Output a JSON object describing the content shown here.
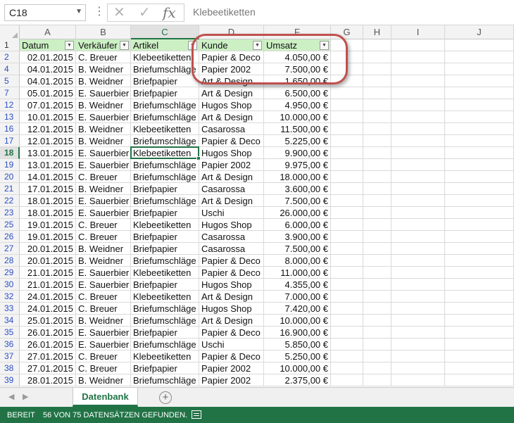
{
  "formula_bar": {
    "name_box": "C18",
    "name_box_arrow": "▼",
    "dots": "⋮",
    "cancel_icon": "✕",
    "enter_icon": "✓",
    "fx_label": "fx",
    "content": "Klebeetiketten"
  },
  "grid": {
    "columns": [
      "A",
      "B",
      "C",
      "D",
      "F",
      "G",
      "H",
      "I",
      "J"
    ],
    "selected_column": "C",
    "header_row_number": "1",
    "headers": [
      "Datum",
      "Verkäufer",
      "Artikel",
      "Kunde",
      "Umsatz"
    ],
    "filter_icon": "▼",
    "active_cell": "C18",
    "rows": [
      {
        "n": "2",
        "cells": [
          "02.01.2015",
          "C. Breuer",
          "Klebeetiketten",
          "Papier & Deco",
          "4.050,00 €"
        ]
      },
      {
        "n": "4",
        "cells": [
          "04.01.2015",
          "B. Weidner",
          "Briefumschläge",
          "Papier 2002",
          "7.500,00 €"
        ]
      },
      {
        "n": "5",
        "cells": [
          "04.01.2015",
          "B. Weidner",
          "Briefpapier",
          "Art & Design",
          "1.650,00 €"
        ]
      },
      {
        "n": "7",
        "cells": [
          "05.01.2015",
          "E. Sauerbier",
          "Briefpapier",
          "Art & Design",
          "6.500,00 €"
        ]
      },
      {
        "n": "12",
        "cells": [
          "07.01.2015",
          "B. Weidner",
          "Briefumschläge",
          "Hugos Shop",
          "4.950,00 €"
        ]
      },
      {
        "n": "13",
        "cells": [
          "10.01.2015",
          "E. Sauerbier",
          "Briefumschläge",
          "Art & Design",
          "10.000,00 €"
        ]
      },
      {
        "n": "16",
        "cells": [
          "12.01.2015",
          "B. Weidner",
          "Klebeetiketten",
          "Casarossa",
          "11.500,00 €"
        ]
      },
      {
        "n": "17",
        "cells": [
          "12.01.2015",
          "B. Weidner",
          "Briefumschläge",
          "Papier & Deco",
          "5.225,00 €"
        ]
      },
      {
        "n": "18",
        "cells": [
          "13.01.2015",
          "E. Sauerbier",
          "Klebeetiketten",
          "Hugos Shop",
          "9.900,00 €"
        ]
      },
      {
        "n": "19",
        "cells": [
          "13.01.2015",
          "E. Sauerbier",
          "Briefumschläge",
          "Papier 2002",
          "9.975,00 €"
        ]
      },
      {
        "n": "20",
        "cells": [
          "14.01.2015",
          "C. Breuer",
          "Briefumschläge",
          "Art & Design",
          "18.000,00 €"
        ]
      },
      {
        "n": "21",
        "cells": [
          "17.01.2015",
          "B. Weidner",
          "Briefpapier",
          "Casarossa",
          "3.600,00 €"
        ]
      },
      {
        "n": "22",
        "cells": [
          "18.01.2015",
          "E. Sauerbier",
          "Briefumschläge",
          "Art & Design",
          "7.500,00 €"
        ]
      },
      {
        "n": "23",
        "cells": [
          "18.01.2015",
          "E. Sauerbier",
          "Briefpapier",
          "Uschi",
          "26.000,00 €"
        ]
      },
      {
        "n": "25",
        "cells": [
          "19.01.2015",
          "C. Breuer",
          "Klebeetiketten",
          "Hugos Shop",
          "6.000,00 €"
        ]
      },
      {
        "n": "26",
        "cells": [
          "19.01.2015",
          "C. Breuer",
          "Briefpapier",
          "Casarossa",
          "3.900,00 €"
        ]
      },
      {
        "n": "27",
        "cells": [
          "20.01.2015",
          "B. Weidner",
          "Briefpapier",
          "Casarossa",
          "7.500,00 €"
        ]
      },
      {
        "n": "28",
        "cells": [
          "20.01.2015",
          "B. Weidner",
          "Briefumschläge",
          "Papier & Deco",
          "8.000,00 €"
        ]
      },
      {
        "n": "29",
        "cells": [
          "21.01.2015",
          "E. Sauerbier",
          "Klebeetiketten",
          "Papier & Deco",
          "11.000,00 €"
        ]
      },
      {
        "n": "30",
        "cells": [
          "21.01.2015",
          "E. Sauerbier",
          "Briefpapier",
          "Hugos Shop",
          "4.355,00 €"
        ]
      },
      {
        "n": "32",
        "cells": [
          "24.01.2015",
          "C. Breuer",
          "Klebeetiketten",
          "Art & Design",
          "7.000,00 €"
        ]
      },
      {
        "n": "33",
        "cells": [
          "24.01.2015",
          "C. Breuer",
          "Briefumschläge",
          "Hugos Shop",
          "7.420,00 €"
        ]
      },
      {
        "n": "34",
        "cells": [
          "25.01.2015",
          "B. Weidner",
          "Briefumschläge",
          "Art & Design",
          "10.000,00 €"
        ]
      },
      {
        "n": "35",
        "cells": [
          "26.01.2015",
          "E. Sauerbier",
          "Briefpapier",
          "Papier & Deco",
          "16.900,00 €"
        ]
      },
      {
        "n": "36",
        "cells": [
          "26.01.2015",
          "E. Sauerbier",
          "Briefumschläge",
          "Uschi",
          "5.850,00 €"
        ]
      },
      {
        "n": "37",
        "cells": [
          "27.01.2015",
          "C. Breuer",
          "Klebeetiketten",
          "Papier & Deco",
          "5.250,00 €"
        ]
      },
      {
        "n": "38",
        "cells": [
          "27.01.2015",
          "C. Breuer",
          "Briefpapier",
          "Papier 2002",
          "10.000,00 €"
        ]
      },
      {
        "n": "39",
        "cells": [
          "28.01.2015",
          "B. Weidner",
          "Briefumschläge",
          "Papier 2002",
          "2.375,00 €"
        ]
      }
    ]
  },
  "sheet_tabs": {
    "nav_left": "◀",
    "nav_right": "▶",
    "active": "Datenbank",
    "add_label": "+"
  },
  "status_bar": {
    "ready": "BEREIT",
    "message": "56 VON 75 DATENSÄTZEN GEFUNDEN."
  },
  "colors": {
    "accent": "#217346",
    "header_fill": "#ccf0c4",
    "highlight": "#c0504d",
    "row_number_blue": "#2b4fc6"
  }
}
